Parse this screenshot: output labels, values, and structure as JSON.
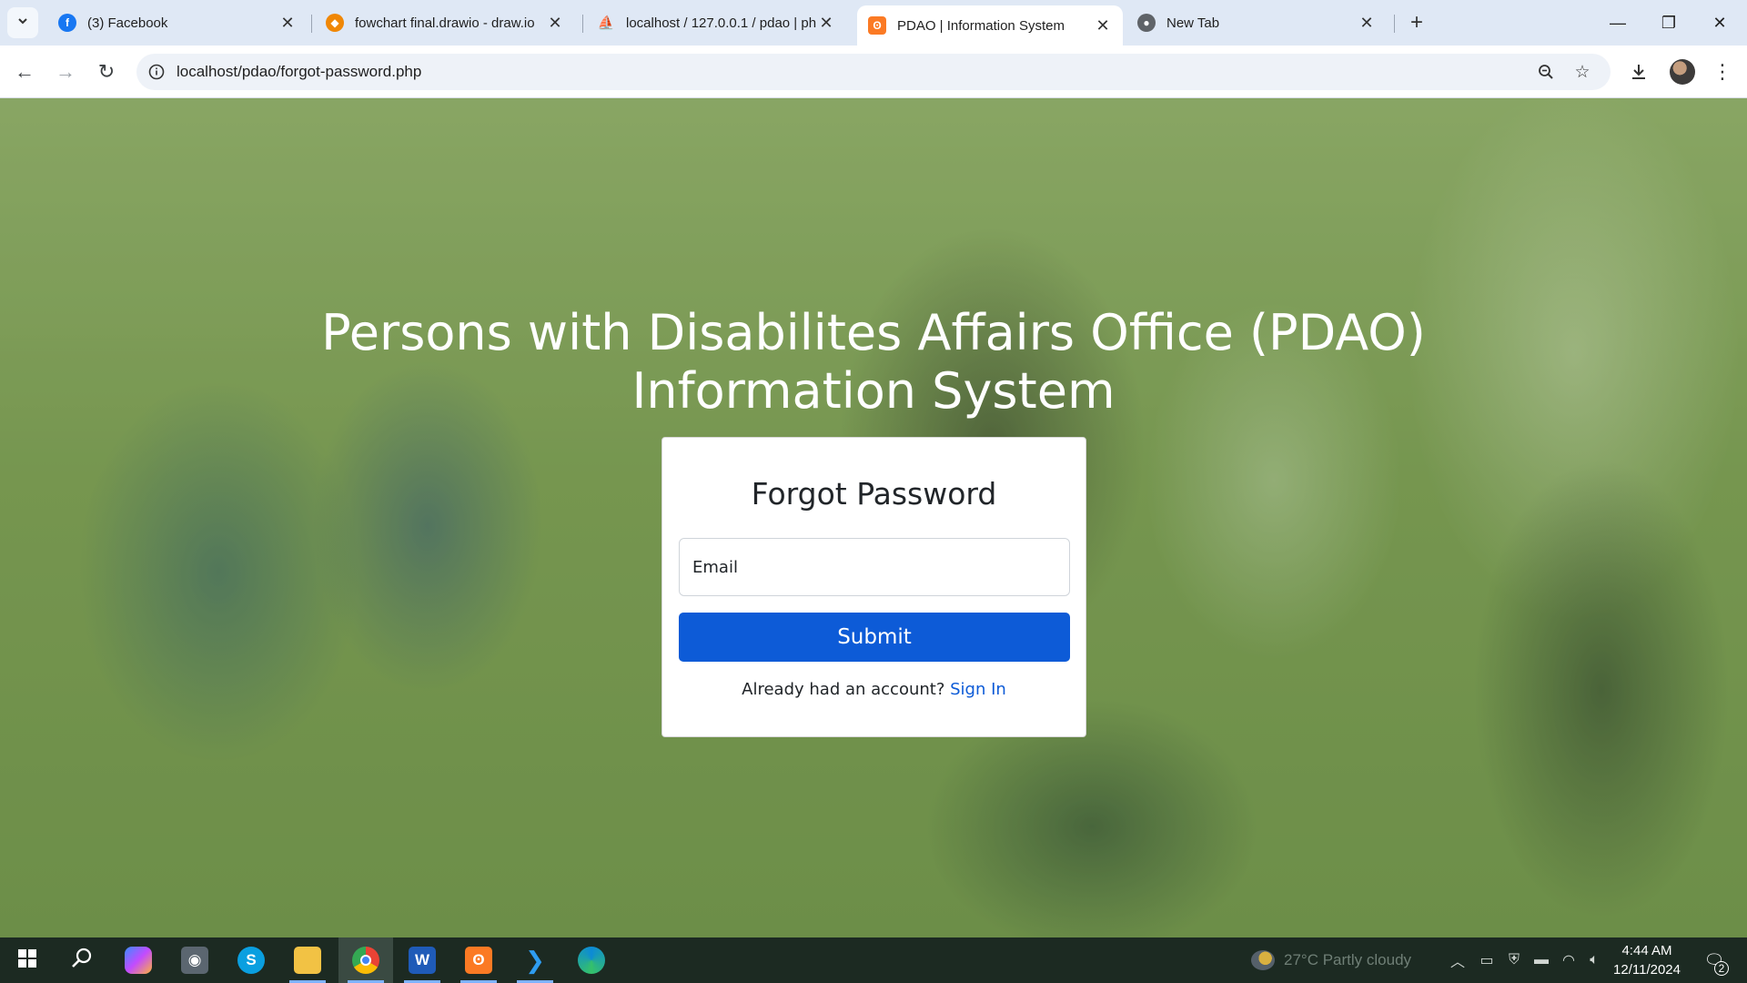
{
  "browser": {
    "tabs": [
      {
        "title": "(3) Facebook",
        "icon": "facebook-icon",
        "color": "#1877f2"
      },
      {
        "title": "fowchart final.drawio - draw.io",
        "icon": "drawio-icon",
        "color": "#f08705"
      },
      {
        "title": "localhost / 127.0.0.1 / pdao | ph",
        "icon": "phpmyadmin-icon",
        "color": "#e6a21e"
      },
      {
        "title": "PDAO | Information System",
        "icon": "xampp-icon",
        "color": "#fb7a24",
        "active": true
      },
      {
        "title": "New Tab",
        "icon": "chrome-icon",
        "color": "#5f6368"
      }
    ],
    "url": "localhost/pdao/forgot-password.php"
  },
  "page": {
    "hero_title": "Persons with Disabilites Affairs Office (PDAO) Information System",
    "card": {
      "title": "Forgot Password",
      "email_placeholder": "Email",
      "submit_label": "Submit",
      "signin_prompt": "Already had an account? ",
      "signin_link": "Sign In"
    },
    "accent_color": "#0d5bd7"
  },
  "taskbar": {
    "apps": [
      "windows-start",
      "search",
      "copilot",
      "camera",
      "skype",
      "file-explorer",
      "chrome",
      "word",
      "xampp",
      "vscode",
      "edge"
    ],
    "weather": "27°C  Partly cloudy",
    "time": "4:44 AM",
    "date": "12/11/2024",
    "notification_count": "2"
  }
}
